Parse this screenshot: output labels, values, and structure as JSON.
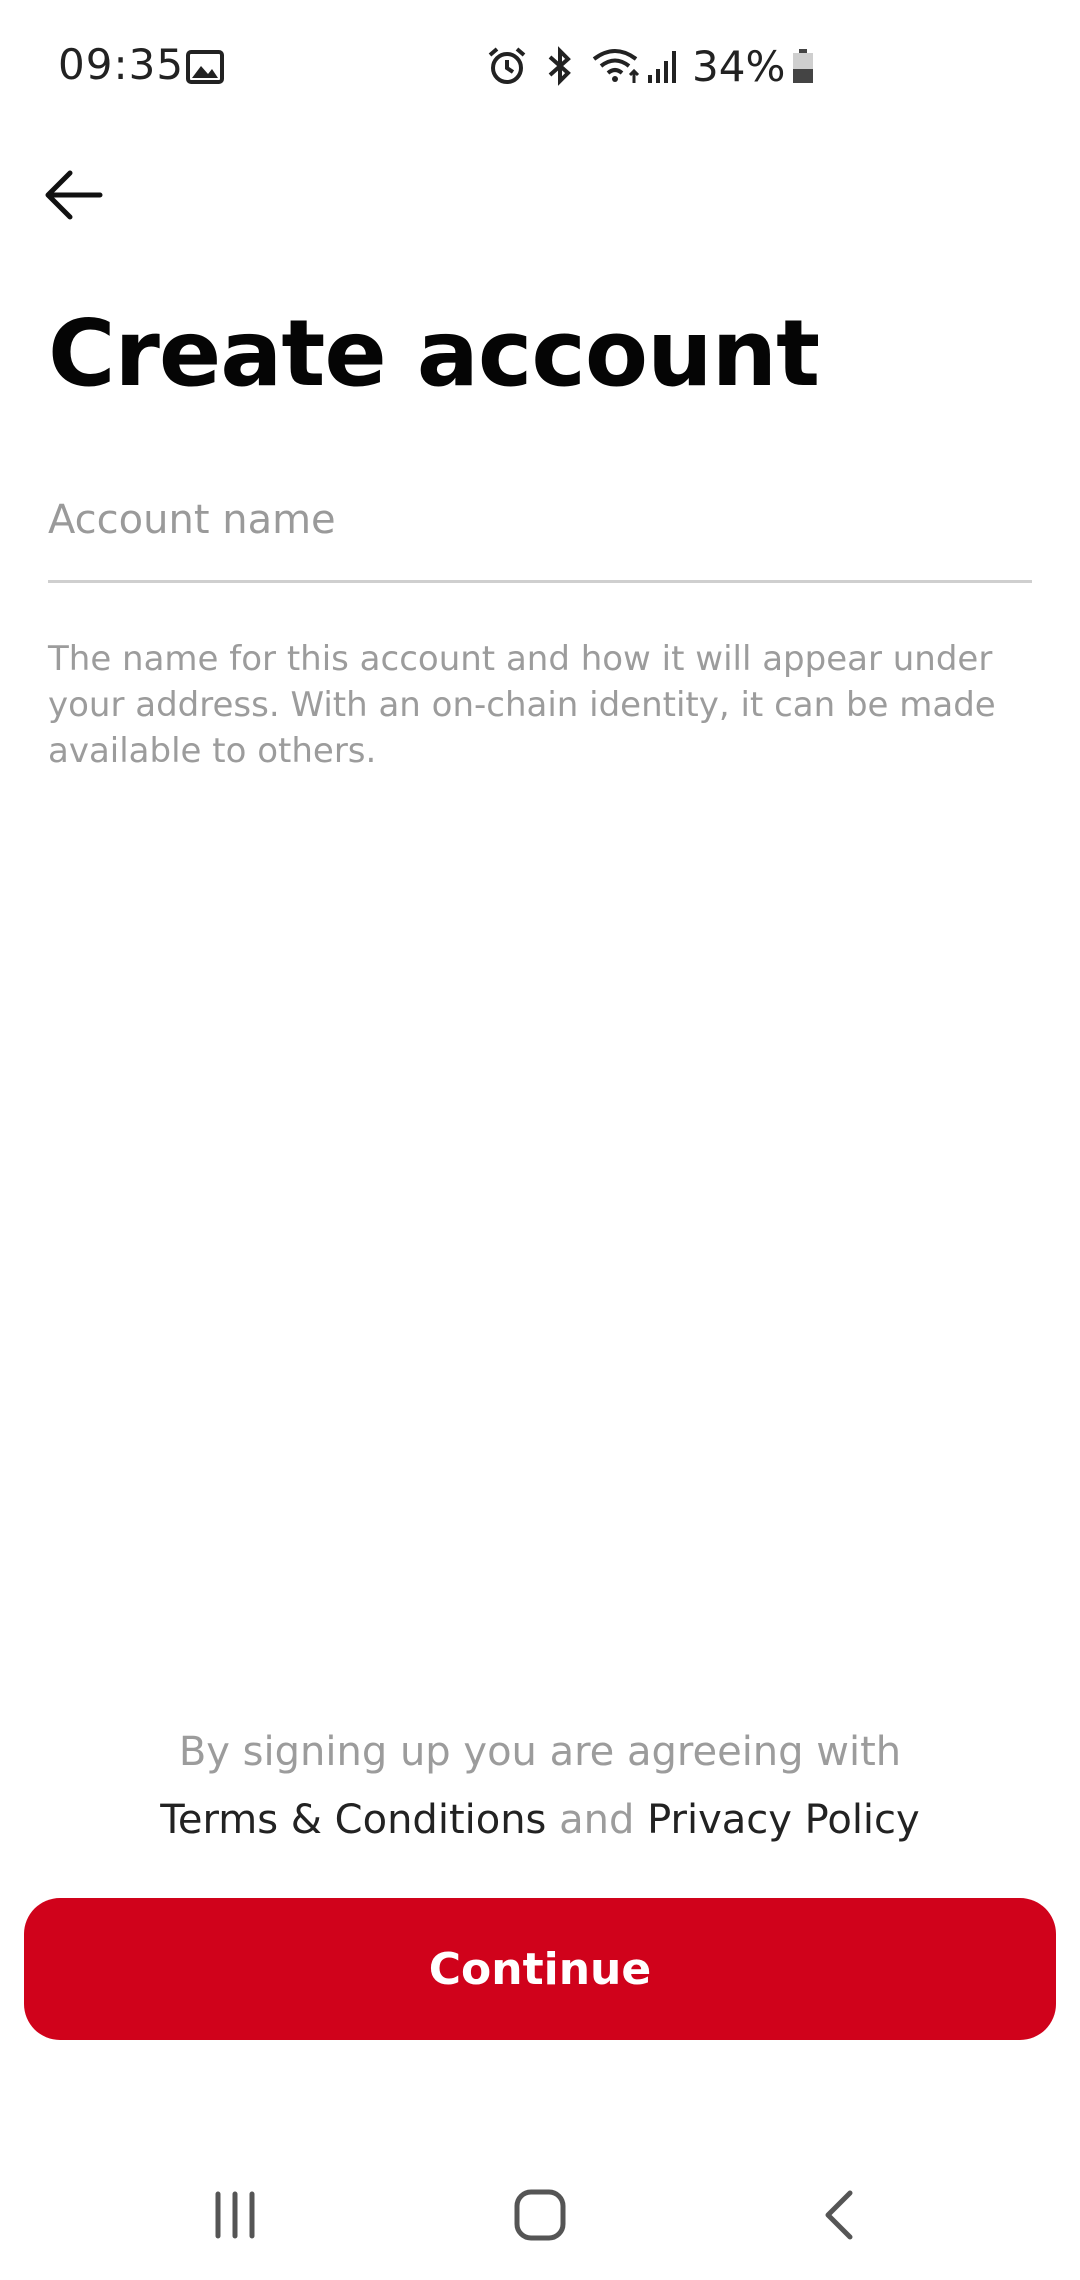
{
  "status_bar": {
    "time": "09:35",
    "battery": "34%",
    "icons": [
      "gallery-icon",
      "alarm-icon",
      "bluetooth-icon",
      "wifi-icon",
      "signal-icon",
      "battery-icon"
    ]
  },
  "header": {
    "back_icon": "arrow-left-icon",
    "title": "Create account"
  },
  "form": {
    "account_name": {
      "value": "",
      "placeholder": "Account name"
    },
    "helper_text": "The name for this account and how it will appear under your address. With an on-chain identity, it can be made available to others."
  },
  "legal": {
    "prefix": "By signing up you are agreeing with",
    "terms": "Terms & Conditions",
    "conjunction": "and",
    "privacy": "Privacy Policy"
  },
  "continue_label": "Continue",
  "colors": {
    "accent": "#d0021b",
    "helper_text": "#9c9c9c"
  },
  "nav_bar": {
    "items": [
      "recent-apps-icon",
      "home-icon",
      "back-icon"
    ]
  }
}
